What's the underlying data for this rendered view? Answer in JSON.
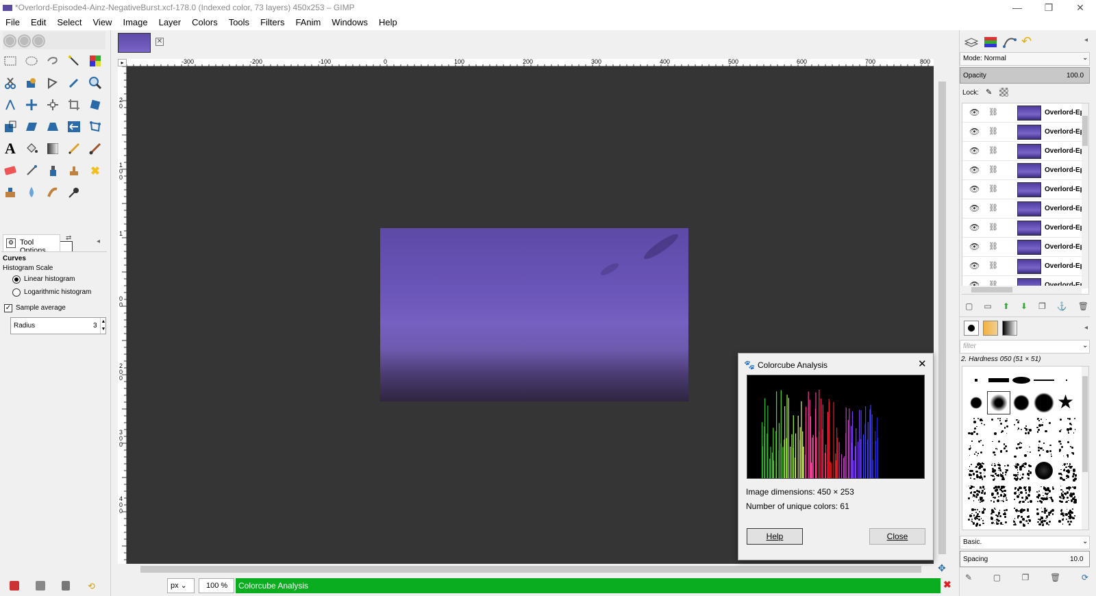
{
  "window": {
    "title": "*Overlord-Episode4-Ainz-NegativeBurst.xcf-178.0 (Indexed color, 73 layers) 450x253 – GIMP",
    "minimize": "—",
    "maximize": "❐",
    "close": "✕"
  },
  "menu": [
    "File",
    "Edit",
    "Select",
    "View",
    "Image",
    "Layer",
    "Colors",
    "Tools",
    "Filters",
    "FAnim",
    "Windows",
    "Help"
  ],
  "tool_options": {
    "tab_label": "Tool Options",
    "tool_name": "Curves",
    "histogram_scale_label": "Histogram Scale",
    "linear_label": "Linear histogram",
    "log_label": "Logarithmic histogram",
    "sample_average_label": "Sample average",
    "radius_label": "Radius",
    "radius_value": "3"
  },
  "ruler": {
    "h_ticks": [
      "-300",
      "-200",
      "-100",
      "0",
      "100",
      "200",
      "300",
      "400",
      "500",
      "600",
      "700",
      "800"
    ],
    "v_ticks": [
      "2",
      "0",
      "1",
      "0",
      "0",
      "1",
      "0",
      "0",
      "2",
      "0",
      "0",
      "3",
      "0",
      "0",
      "4",
      "0",
      "0"
    ]
  },
  "dialog": {
    "title": "Colorcube Analysis",
    "dimensions_label": "Image dimensions: 450 × 253",
    "colors_label": "Number of unique colors: 61",
    "help_button": "Help",
    "close_button": "Close"
  },
  "statusbar": {
    "unit": "px",
    "zoom": "100 %",
    "message": "Colorcube Analysis"
  },
  "layers": {
    "mode_label": "Mode: Normal",
    "opacity_label": "Opacity",
    "opacity_value": "100.0",
    "lock_label": "Lock:",
    "rows": [
      "Overlord-Ep",
      "Overlord-Ep",
      "Overlord-Ep",
      "Overlord-Ep",
      "Overlord-Ep",
      "Overlord-Ep",
      "Overlord-Ep",
      "Overlord-Ep",
      "Overlord-Ep",
      "Overlord-Ep"
    ]
  },
  "brushes": {
    "filter_placeholder": "filter",
    "brush_name": "2. Hardness 050 (51 × 51)",
    "preset": "Basic.",
    "spacing_label": "Spacing",
    "spacing_value": "10.0"
  },
  "colors": {
    "accent_green": "#0aad1f",
    "canvas_bg": "#353535",
    "image_purple": "#6a55b8"
  }
}
